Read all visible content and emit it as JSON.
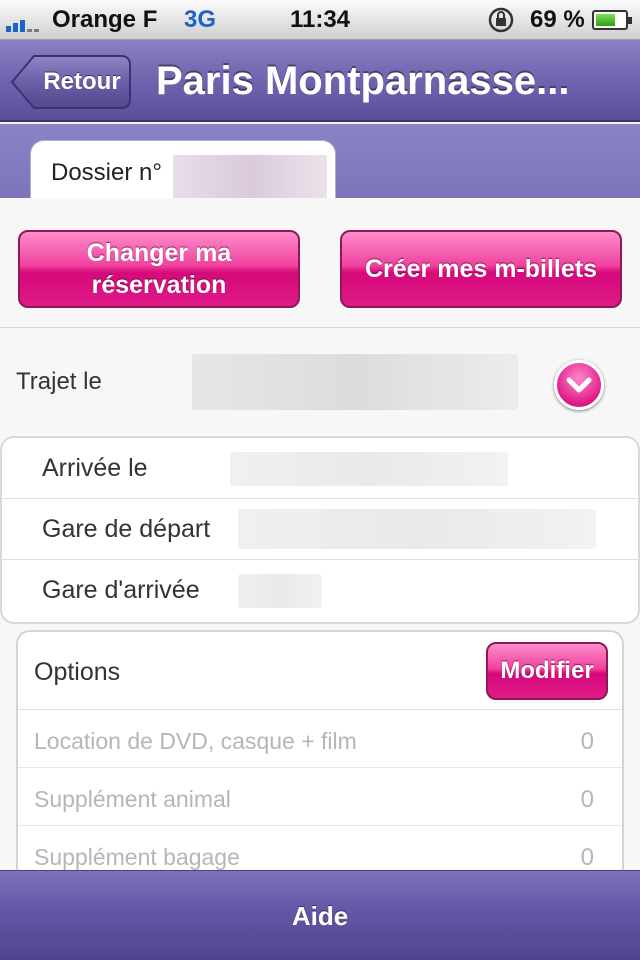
{
  "status_bar": {
    "carrier": "Orange F",
    "network": "3G",
    "time": "11:34",
    "battery_percent": "69 %",
    "battery_level": 0.69
  },
  "nav": {
    "back_label": "Retour",
    "title": "Paris Montparnasse..."
  },
  "tab": {
    "label": "Dossier n°"
  },
  "actions": {
    "change_reservation": "Changer ma réservation",
    "create_tickets": "Créer mes m-billets"
  },
  "trajet": {
    "label": "Trajet le"
  },
  "details": {
    "arrival_date_label": "Arrivée le",
    "departure_station_label": "Gare de départ",
    "arrival_station_label": "Gare d'arrivée"
  },
  "options": {
    "title": "Options",
    "modify_label": "Modifier",
    "items": [
      {
        "label": "Location de DVD, casque + film",
        "value": "0"
      },
      {
        "label": "Supplément animal",
        "value": "0"
      },
      {
        "label": "Supplément bagage",
        "value": "0"
      }
    ]
  },
  "toolbar": {
    "help_label": "Aide"
  },
  "colors": {
    "nav_purple": "#6f64ae",
    "accent_pink": "#e01a88"
  }
}
